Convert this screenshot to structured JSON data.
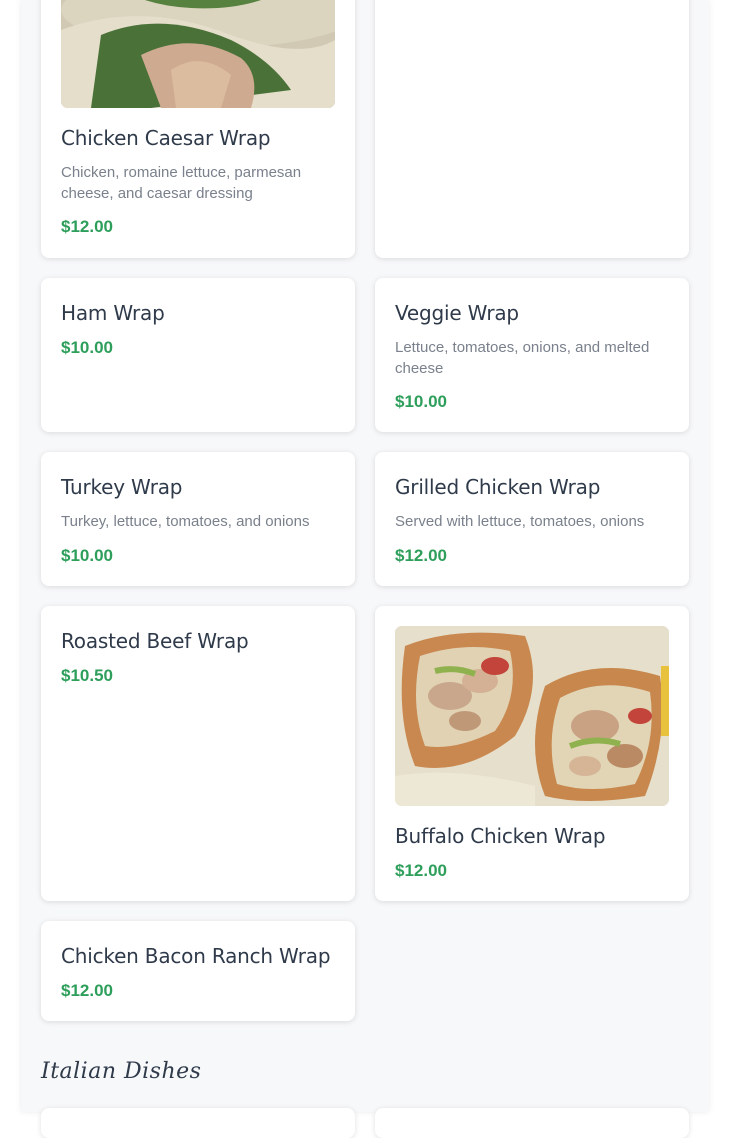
{
  "menu": {
    "items": [
      {
        "title": "Chicken Caesar Wrap",
        "description": "Chicken, romaine lettuce, parmesan cheese, and caesar dressing",
        "price": "$12.00",
        "image": "chicken-caesar-wrap-photo"
      },
      {
        "title": "Ham Wrap",
        "description": "",
        "price": "$10.00"
      },
      {
        "title": "Veggie Wrap",
        "description": "Lettuce, tomatoes, onions, and melted cheese",
        "price": "$10.00"
      },
      {
        "title": "Turkey Wrap",
        "description": "Turkey, lettuce, tomatoes, and onions",
        "price": "$10.00"
      },
      {
        "title": "Grilled Chicken Wrap",
        "description": "Served with lettuce, tomatoes, onions",
        "price": "$12.00"
      },
      {
        "title": "Roasted Beef Wrap",
        "description": "",
        "price": "$10.50"
      },
      {
        "title": "Buffalo Chicken Wrap",
        "description": "",
        "price": "$12.00",
        "image": "buffalo-chicken-wrap-photo"
      },
      {
        "title": "Chicken Bacon Ranch Wrap",
        "description": "",
        "price": "$12.00"
      }
    ]
  },
  "next_section": {
    "title": "Italian Dishes"
  },
  "colors": {
    "price": "#2e9e5b",
    "title": "#2f3a4a",
    "description": "#7a818c",
    "background": "#f7f8fa"
  }
}
